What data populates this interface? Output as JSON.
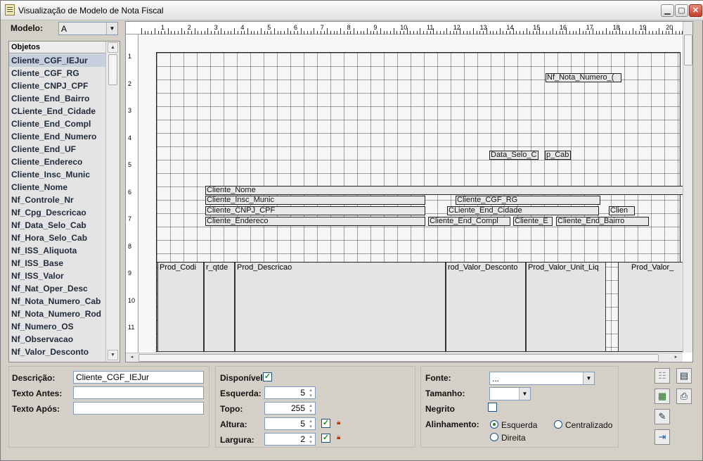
{
  "window": {
    "title": "Visualização de Modelo de Nota Fiscal"
  },
  "modelo": {
    "label": "Modelo:",
    "value": "A"
  },
  "objects": {
    "header": "Objetos",
    "items": [
      "Cliente_CGF_IEJur",
      "Cliente_CGF_RG",
      "Cliente_CNPJ_CPF",
      "Cliente_End_Bairro",
      "CLiente_End_Cidade",
      "Cliente_End_Compl",
      "Cliente_End_Numero",
      "Cliente_End_UF",
      "Cliente_Endereco",
      "Cliente_Insc_Munic",
      "Cliente_Nome",
      "Nf_Controle_Nr",
      "Nf_Cpg_Descricao",
      "Nf_Data_Selo_Cab",
      "Nf_Hora_Selo_Cab",
      "Nf_ISS_Aliquota",
      "Nf_ISS_Base",
      "Nf_ISS_Valor",
      "Nf_Nat_Oper_Desc",
      "Nf_Nota_Numero_Cab",
      "Nf_Nota_Numero_Rod",
      "Nf_Numero_OS",
      "Nf_Observacao",
      "Nf_Valor_Desconto"
    ],
    "selected": "Cliente_CGF_IEJur"
  },
  "ruler": {
    "h": [
      "1",
      "2",
      "3",
      "4",
      "5",
      "6",
      "7",
      "8",
      "9",
      "10",
      "11",
      "12",
      "13",
      "14",
      "15",
      "16",
      "17",
      "18",
      "19",
      "20"
    ],
    "v": [
      "1",
      "2",
      "3",
      "4",
      "5",
      "6",
      "7",
      "8",
      "9",
      "10",
      "11"
    ]
  },
  "design": {
    "fields": {
      "nf_nota_numero": "Nf_Nota_Numero_(",
      "data_selo": "Data_Selo_C",
      "cab": "p_Cab",
      "cliente_nome": "Cliente_Nome",
      "insc_munic": "Cliente_Insc_Munic",
      "cgf_rg": "Cliente_CGF_RG",
      "cnpj_cpf": "Cliente_CNPJ_CPF",
      "end_cidade": "CLiente_End_Cidade",
      "clien": "Clien",
      "endereco": "Cliente_Endereco",
      "end_compl": "Cliente_End_Compl",
      "cliente_e": "Cliente_E",
      "end_bairro": "Cliente_End_Bairro"
    },
    "columns": [
      "Prod_Codi",
      "r_qtde",
      "Prod_Descricao",
      "rod_Valor_Desconto",
      "Prod_Valor_Unit_Liq",
      "Prod_Valor_"
    ]
  },
  "props": {
    "descricao": {
      "label": "Descrição:",
      "value": "Cliente_CGF_IEJur"
    },
    "texto_antes": {
      "label": "Texto Antes:",
      "value": ""
    },
    "texto_apos": {
      "label": "Texto Após:",
      "value": ""
    },
    "disponivel": {
      "label": "Disponível",
      "checked": true
    },
    "esquerda": {
      "label": "Esquerda:",
      "value": "5"
    },
    "topo": {
      "label": "Topo:",
      "value": "255"
    },
    "altura": {
      "label": "Altura:",
      "value": "5"
    },
    "largura": {
      "label": "Largura:",
      "value": "2"
    }
  },
  "font": {
    "fonte": {
      "label": "Fonte:",
      "value": "..."
    },
    "tamanho": {
      "label": "Tamanho:",
      "value": ""
    },
    "negrito": {
      "label": "Negrito",
      "checked": false
    },
    "alinhamento": {
      "label": "Alinhamento:",
      "options": [
        "Esquerda",
        "Centralizado",
        "Direita"
      ],
      "selected": "Esquerda"
    }
  }
}
